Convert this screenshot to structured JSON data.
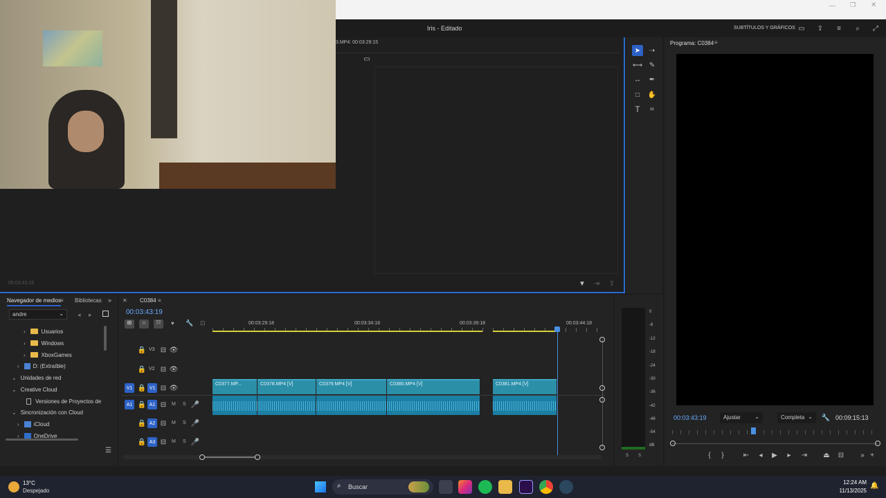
{
  "window": {
    "title": "Iris - Editado",
    "workspace_label": "SUBTÍTULOS Y GRÁFICOS"
  },
  "source_monitor": {
    "clip_label": "3.MP4: 00:03:29:15",
    "timecode": "00:03:43:19"
  },
  "program_monitor": {
    "title": "Programa: C0384",
    "timecode": "00:03:43:19",
    "fit_label": "Ajustar",
    "quality_label": "Completa",
    "duration": "00:09:15:13"
  },
  "media_browser": {
    "tab_media": "Navegador de medios",
    "tab_libraries": "Bibliotecas",
    "location": "andre",
    "tree": [
      {
        "label": "Usuarios",
        "type": "folder"
      },
      {
        "label": "Windows",
        "type": "folder"
      },
      {
        "label": "XboxGames",
        "type": "folder"
      },
      {
        "label": "D: (Extraíble)",
        "type": "drive"
      },
      {
        "label": "Unidades de red",
        "type": "section"
      },
      {
        "label": "Creative Cloud",
        "type": "section"
      },
      {
        "label": "Versiones de Proyectos de",
        "type": "item"
      },
      {
        "label": "Sincronización con Cloud",
        "type": "section"
      },
      {
        "label": "iCloud",
        "type": "cloud"
      },
      {
        "label": "OneDrive",
        "type": "cloud"
      }
    ]
  },
  "timeline": {
    "sequence_name": "C0384",
    "timecode": "00:03:43:19",
    "ruler_labels": [
      "00:03:29:18",
      "00:03:34:18",
      "00:03:39:18",
      "00:03:44:18"
    ],
    "tracks": [
      {
        "target": "",
        "name": "V3"
      },
      {
        "target": "",
        "name": "V2"
      },
      {
        "target": "V1",
        "name": "V1"
      },
      {
        "target": "A1",
        "name": "A1"
      },
      {
        "target": "",
        "name": "A2"
      },
      {
        "target": "",
        "name": "A3"
      }
    ],
    "track_m": "M",
    "track_s": "S",
    "clips": [
      "C0377.MP...",
      "C0378.MP4 [V]",
      "C0379.MP4 [V]",
      "C0380.MP4 [V]",
      "C0381.MP4 [V]"
    ]
  },
  "audio_meter": {
    "scale": [
      "0",
      "-6",
      "-12",
      "-18",
      "-24",
      "-30",
      "-36",
      "-42",
      "-48",
      "-54",
      "dB"
    ],
    "footer": [
      "S",
      "S"
    ]
  },
  "taskbar": {
    "temperature": "13°C",
    "weather": "Despejado",
    "search": "Buscar",
    "time": "12:24 AM",
    "date": "11/13/2025"
  },
  "colors": {
    "accent_blue": "#2d62c6",
    "clip_video": "#2c8fa8",
    "clip_audio": "#1b7ea3",
    "playhead": "#4a90e2",
    "timecode_blue": "#6aa9ff"
  }
}
